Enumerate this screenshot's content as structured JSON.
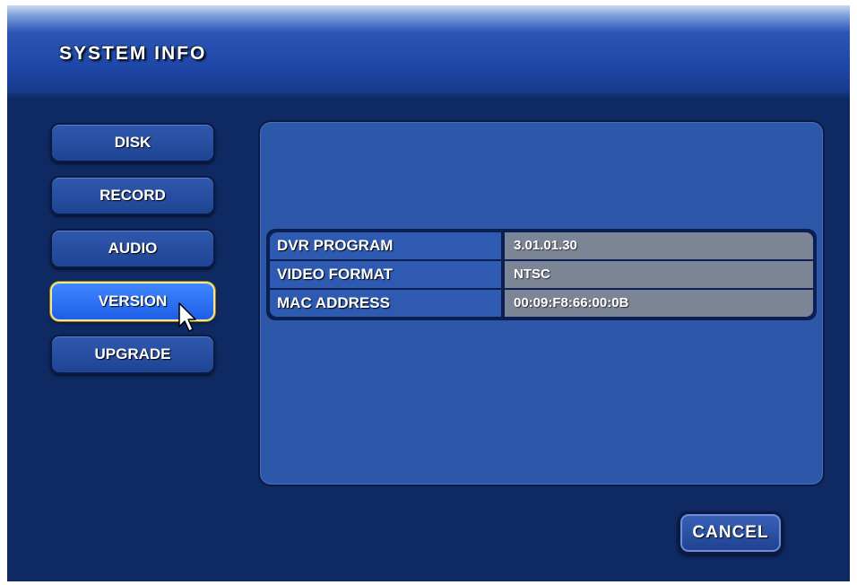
{
  "header": {
    "title": "SYSTEM INFO"
  },
  "sidebar": {
    "items": [
      {
        "label": "DISK"
      },
      {
        "label": "RECORD"
      },
      {
        "label": "AUDIO"
      },
      {
        "label": "VERSION",
        "selected": true
      },
      {
        "label": "UPGRADE"
      }
    ]
  },
  "info_table": {
    "rows": [
      {
        "label": "DVR PROGRAM",
        "value": "3.01.01.30"
      },
      {
        "label": "VIDEO FORMAT",
        "value": "NTSC"
      },
      {
        "label": "MAC ADDRESS",
        "value": "00:09:F8:66:00:0B"
      }
    ]
  },
  "footer": {
    "cancel_label": "CANCEL"
  },
  "colors": {
    "background": "#0f2a63",
    "panel": "#2d57a8",
    "active_button": "#1d5fe6",
    "active_border": "#f5e78a",
    "value_cell": "#7b8596"
  },
  "icons": {
    "cursor": "mouse-pointer-icon"
  }
}
